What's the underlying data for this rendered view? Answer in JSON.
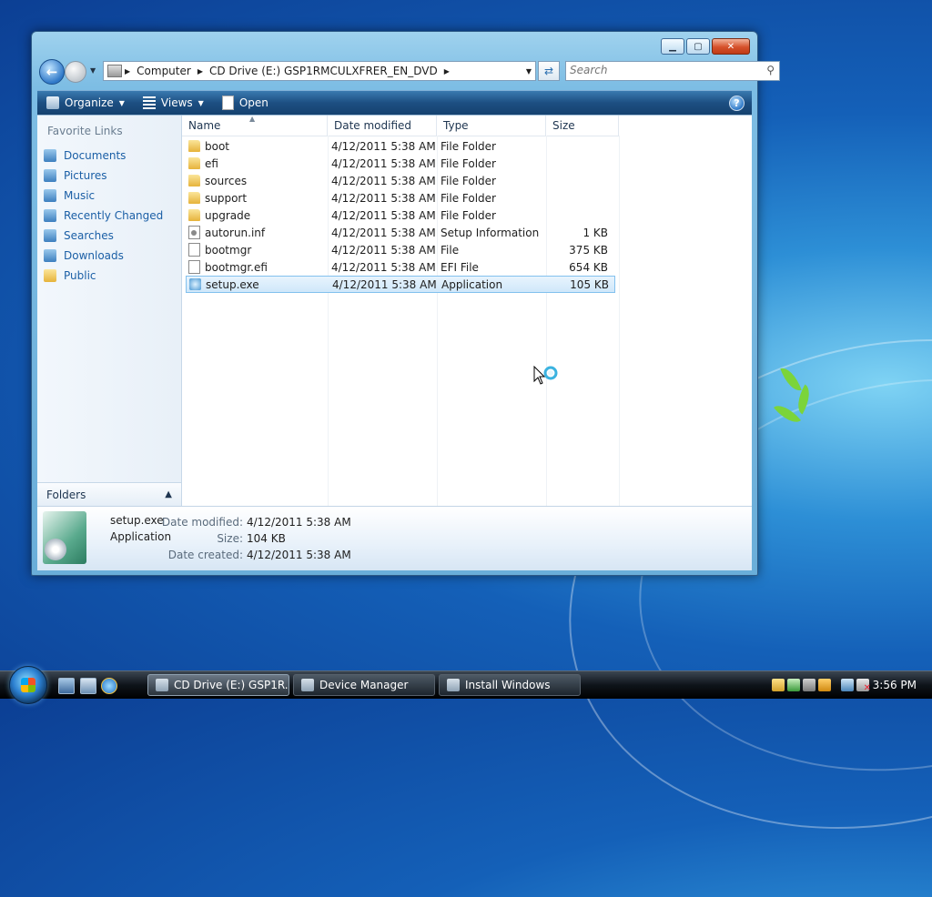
{
  "colors": {
    "link": "#1b5fa6",
    "toolbar": "#1d4f82",
    "selection": "#cfe7fa",
    "close_button": "#d5512b"
  },
  "window": {
    "controls": {
      "minimize": "▁",
      "maximize": "▢",
      "close": "✕"
    },
    "address": {
      "crumbs": [
        "Computer",
        "CD Drive (E:) GSP1RMCULXFRER_EN_DVD"
      ],
      "drive_icon": "drive-icon"
    },
    "search": {
      "placeholder": "Search"
    },
    "toolbar": {
      "organize": "Organize",
      "views": "Views",
      "open": "Open",
      "help": "?"
    },
    "nav": {
      "title": "Favorite Links",
      "items": [
        {
          "label": "Documents",
          "icon": "documents-icon"
        },
        {
          "label": "Pictures",
          "icon": "pictures-icon"
        },
        {
          "label": "Music",
          "icon": "music-icon"
        },
        {
          "label": "Recently Changed",
          "icon": "recently-changed-icon"
        },
        {
          "label": "Searches",
          "icon": "searches-icon"
        },
        {
          "label": "Downloads",
          "icon": "downloads-icon"
        },
        {
          "label": "Public",
          "icon": "public-folder-icon"
        }
      ],
      "folders_label": "Folders"
    },
    "columns": [
      "Name",
      "Date modified",
      "Type",
      "Size"
    ],
    "files": [
      {
        "name": "boot",
        "date": "4/12/2011 5:38 AM",
        "type": "File Folder",
        "size": ""
      },
      {
        "name": "efi",
        "date": "4/12/2011 5:38 AM",
        "type": "File Folder",
        "size": ""
      },
      {
        "name": "sources",
        "date": "4/12/2011 5:38 AM",
        "type": "File Folder",
        "size": ""
      },
      {
        "name": "support",
        "date": "4/12/2011 5:38 AM",
        "type": "File Folder",
        "size": ""
      },
      {
        "name": "upgrade",
        "date": "4/12/2011 5:38 AM",
        "type": "File Folder",
        "size": ""
      },
      {
        "name": "autorun.inf",
        "date": "4/12/2011 5:38 AM",
        "type": "Setup Information",
        "size": "1 KB"
      },
      {
        "name": "bootmgr",
        "date": "4/12/2011 5:38 AM",
        "type": "File",
        "size": "375 KB"
      },
      {
        "name": "bootmgr.efi",
        "date": "4/12/2011 5:38 AM",
        "type": "EFI File",
        "size": "654 KB"
      },
      {
        "name": "setup.exe",
        "date": "4/12/2011 5:38 AM",
        "type": "Application",
        "size": "105 KB"
      }
    ],
    "details": {
      "name": "setup.exe",
      "type": "Application",
      "labels": {
        "modified": "Date modified:",
        "size": "Size:",
        "created": "Date created:"
      },
      "values": {
        "modified": "4/12/2011 5:38 AM",
        "size": "104 KB",
        "created": "4/12/2011 5:38 AM"
      }
    }
  },
  "taskbar": {
    "tasks": [
      {
        "label": "CD Drive (E:) GSP1R...",
        "icon": "drive-icon"
      },
      {
        "label": "Device Manager",
        "icon": "device-manager-icon"
      },
      {
        "label": "Install Windows",
        "icon": "install-windows-icon"
      }
    ],
    "clock": "3:56 PM"
  }
}
